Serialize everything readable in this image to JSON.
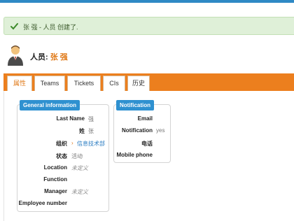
{
  "alert": {
    "text": "张 强 - 人员 创建了."
  },
  "person": {
    "label": "人员:",
    "name": "张 强"
  },
  "tabs": [
    {
      "label": "属性",
      "active": true
    },
    {
      "label": "Teams",
      "active": false
    },
    {
      "label": "Tickets",
      "active": false
    },
    {
      "label": "CIs",
      "active": false
    },
    {
      "label": "历史",
      "active": false
    }
  ],
  "general": {
    "legend": "General information",
    "fields": [
      {
        "label": "Last Name",
        "value": "强"
      },
      {
        "label": "姓",
        "value": "张"
      },
      {
        "label": "组织",
        "value": "信息技术部"
      },
      {
        "label": "状态",
        "value": "活动"
      },
      {
        "label": "Location",
        "value": "未定义"
      },
      {
        "label": "Function",
        "value": ""
      },
      {
        "label": "Manager",
        "value": "未定义"
      },
      {
        "label": "Employee number",
        "value": ""
      }
    ]
  },
  "notification": {
    "legend": "Notification",
    "fields": [
      {
        "label": "Email",
        "value": ""
      },
      {
        "label": "Notification",
        "value": "yes"
      },
      {
        "label": "电话",
        "value": ""
      },
      {
        "label": "Mobile phone",
        "value": ""
      }
    ]
  },
  "colors": {
    "accent": "#ec7f1e",
    "legend": "#2f91d0",
    "link": "#2a7cc2",
    "success_bg": "#dff0d8"
  }
}
